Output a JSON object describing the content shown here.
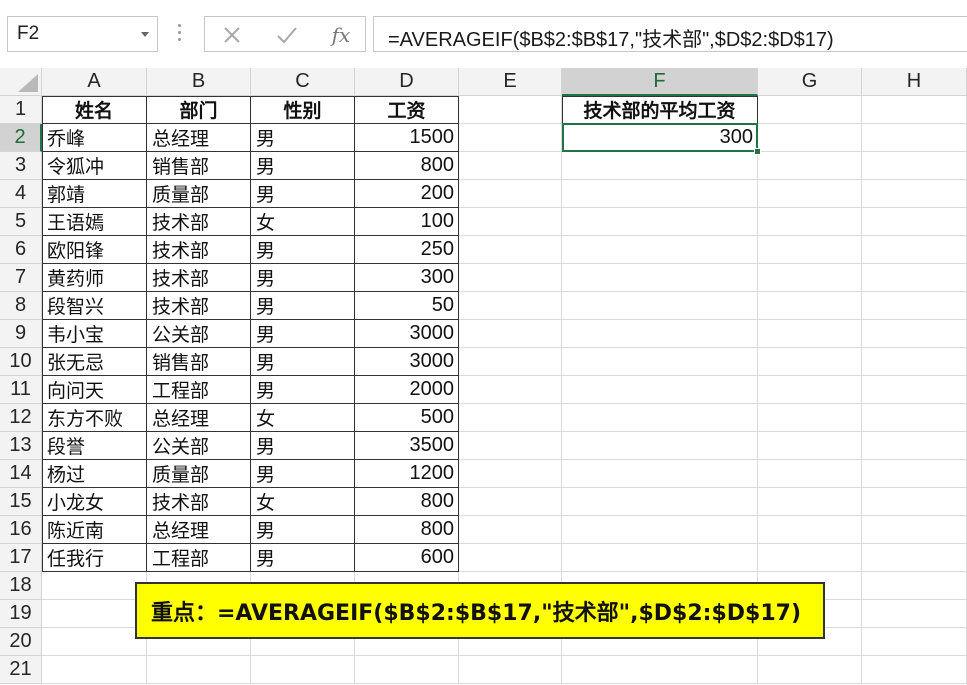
{
  "formula_bar": {
    "name_box": "F2",
    "formula": "=AVERAGEIF($B$2:$B$17,\"技术部\",$D$2:$D$17)",
    "cancel_icon": "close-icon",
    "enter_icon": "check-icon",
    "fx_label": "fx"
  },
  "columns": [
    "A",
    "B",
    "C",
    "D",
    "E",
    "F",
    "G",
    "H"
  ],
  "rows": [
    "1",
    "2",
    "3",
    "4",
    "5",
    "6",
    "7",
    "8",
    "9",
    "10",
    "11",
    "12",
    "13",
    "14",
    "15",
    "16",
    "17",
    "18",
    "19",
    "20",
    "21"
  ],
  "table": {
    "headers": [
      "姓名",
      "部门",
      "性别",
      "工资"
    ],
    "rows": [
      [
        "乔峰",
        "总经理",
        "男",
        "1500"
      ],
      [
        "令狐冲",
        "销售部",
        "男",
        "800"
      ],
      [
        "郭靖",
        "质量部",
        "男",
        "200"
      ],
      [
        "王语嫣",
        "技术部",
        "女",
        "100"
      ],
      [
        "欧阳锋",
        "技术部",
        "男",
        "250"
      ],
      [
        "黄药师",
        "技术部",
        "男",
        "300"
      ],
      [
        "段智兴",
        "技术部",
        "男",
        "50"
      ],
      [
        "韦小宝",
        "公关部",
        "男",
        "3000"
      ],
      [
        "张无忌",
        "销售部",
        "男",
        "3000"
      ],
      [
        "向问天",
        "工程部",
        "男",
        "2000"
      ],
      [
        "东方不败",
        "总经理",
        "女",
        "500"
      ],
      [
        "段誉",
        "公关部",
        "男",
        "3500"
      ],
      [
        "杨过",
        "质量部",
        "男",
        "1200"
      ],
      [
        "小龙女",
        "技术部",
        "女",
        "800"
      ],
      [
        "陈近南",
        "总经理",
        "男",
        "800"
      ],
      [
        "任我行",
        "工程部",
        "男",
        "600"
      ]
    ]
  },
  "result": {
    "header": "技术部的平均工资",
    "value": "300"
  },
  "selection": {
    "cell": "F2",
    "column": "F",
    "row": "2"
  },
  "callout": {
    "text": "重点：=AVERAGEIF($B$2:$B$17,\"技术部\",$D$2:$D$17)"
  },
  "colors": {
    "accent": "#217346",
    "callout_bg": "#ffff00"
  }
}
